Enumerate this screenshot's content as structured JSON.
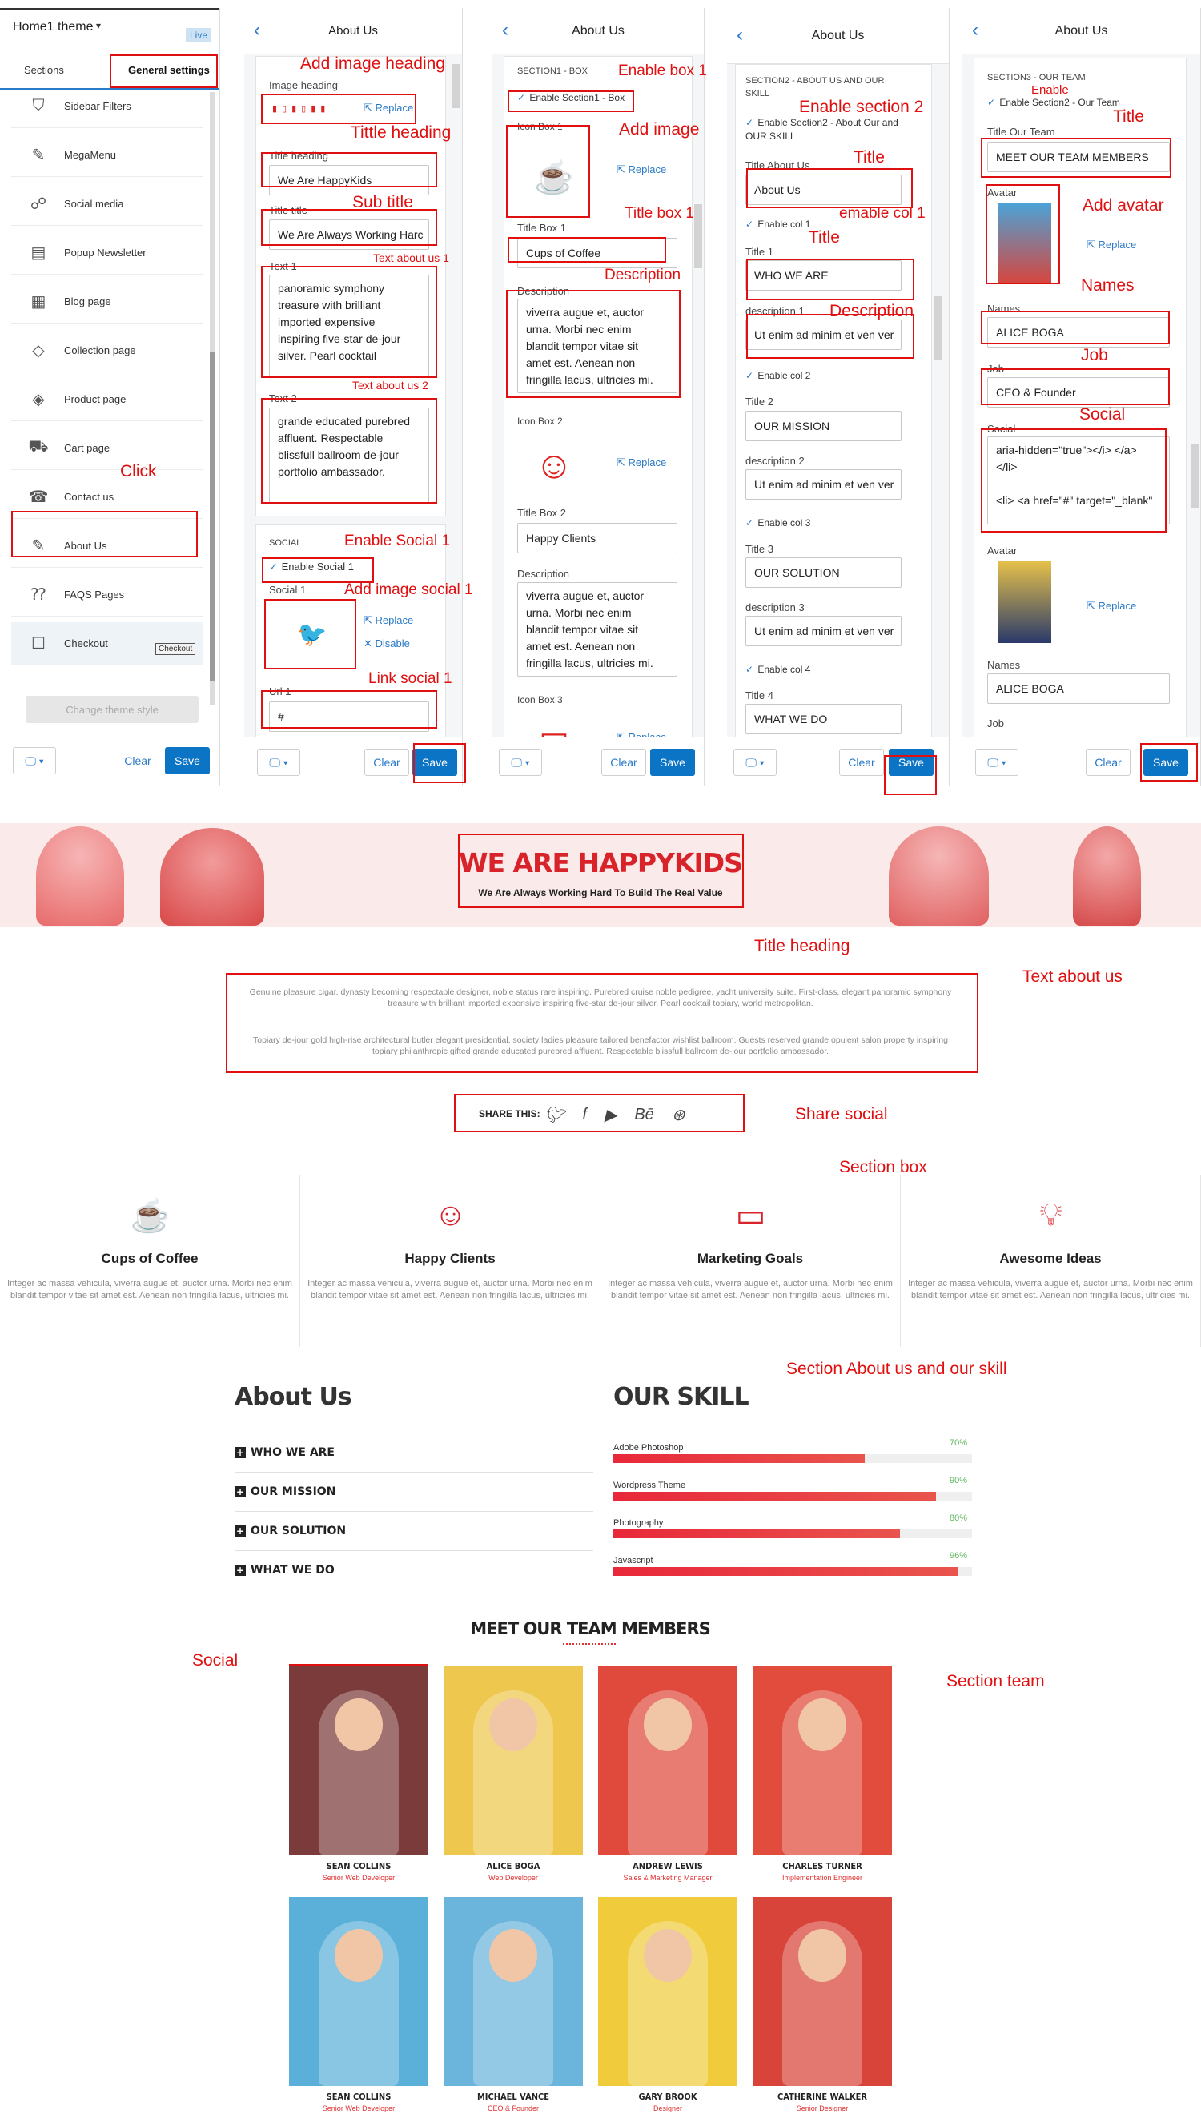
{
  "panel1": {
    "theme_name": "Home1 theme",
    "live_badge": "Live",
    "tab_sections": "Sections",
    "tab_general": "General settings",
    "items": [
      "Sidebar Filters",
      "MegaMenu",
      "Social media",
      "Popup Newsletter",
      "Blog page",
      "Collection page",
      "Product page",
      "Cart page",
      "Contact us",
      "About Us",
      "FAQS Pages",
      "Checkout"
    ],
    "tooltip": "Checkout",
    "change_style": "Change theme style",
    "clear": "Clear",
    "save": "Save"
  },
  "panel2": {
    "title": "About Us",
    "image_heading_label": "Image heading",
    "replace": "Replace",
    "title_heading_label": "Title heading",
    "title_heading_value": "We Are HappyKids",
    "title_title_label": "Title title",
    "title_title_value": "We Are Always Working Harc",
    "text1_label": "Text 1",
    "text1_value": "panoramic symphony treasure with brilliant imported expensive inspiring five-star de-jour silver. Pearl cocktail",
    "text2_label": "Text 2",
    "text2_value": "grande educated purebred affluent. Respectable blissfull ballroom de-jour portfolio ambassador.",
    "social_heading": "SOCIAL",
    "enable_social1": "Enable Social 1",
    "social1_label": "Social 1",
    "disable": "Disable",
    "url1_label": "Url 1",
    "url1_value": "#",
    "clear": "Clear",
    "save": "Save"
  },
  "panel3": {
    "title": "About Us",
    "section_heading": "SECTION1 - BOX",
    "enable_box": "Enable Section1 - Box",
    "icon_box1": "Icon Box 1",
    "title_box1_label": "Title Box 1",
    "title_box1_value": "Cups of Coffee",
    "desc_label": "Description",
    "desc_value": "viverra augue et, auctor urna. Morbi nec enim blandit tempor vitae sit amet est. Aenean non fringilla lacus, ultricies mi.",
    "icon_box2": "Icon Box 2",
    "title_box2_label": "Title Box 2",
    "title_box2_value": "Happy Clients",
    "desc2_label": "Description",
    "desc2_value": "viverra augue et, auctor urna. Morbi nec enim blandit tempor vitae sit amet est. Aenean non fringilla lacus, ultricies mi.",
    "icon_box3": "Icon Box 3",
    "replace": "Replace",
    "clear": "Clear",
    "save": "Save"
  },
  "panel4": {
    "title": "About Us",
    "section_heading": "SECTION2 - ABOUT US AND OUR SKILL",
    "enable_section2": "Enable Section2 - About Our and OUR SKILL",
    "title_about_label": "Title About Us",
    "title_about_value": "About Us",
    "enable_col1": "Enable col 1",
    "title1_label": "Title 1",
    "title1_value": "WHO WE ARE",
    "desc1_label": "description 1",
    "desc1_value": "Ut enim ad minim et ven ver",
    "enable_col2": "Enable col 2",
    "title2_label": "Title 2",
    "title2_value": "OUR MISSION",
    "desc2_label": "description 2",
    "desc2_value": "Ut enim ad minim et ven ver",
    "enable_col3": "Enable col 3",
    "title3_label": "Title 3",
    "title3_value": "OUR SOLUTION",
    "desc3_label": "description 3",
    "desc3_value": "Ut enim ad minim et ven ver",
    "enable_col4": "Enable col 4",
    "title4_label": "Title 4",
    "title4_value": "WHAT WE DO",
    "clear": "Clear",
    "save": "Save"
  },
  "panel5": {
    "title": "About Us",
    "section_heading": "SECTION3 - OUR TEAM",
    "enable_section2": "Enable Section2 - Our Team",
    "title_team_label": "Title Our Team",
    "title_team_value": "MEET OUR TEAM MEMBERS",
    "avatar_label": "Avatar",
    "replace": "Replace",
    "names_label": "Names",
    "names_value": "ALICE BOGA",
    "job_label": "Job",
    "job_value": "CEO & Founder",
    "social_label": "Social",
    "social_value": "aria-hidden=\"true\"></i> </a></li>\n\n<li> <a href=\"#\" target=\"_blank\"",
    "avatar2_label": "Avatar",
    "names2_label": "Names",
    "names2_value": "ALICE BOGA",
    "job2_label": "Job",
    "clear": "Clear",
    "save": "Save"
  },
  "annotations": {
    "add_image_heading": "Add image heading",
    "tittle_heading": "Tittle heading",
    "sub_title": "Sub title",
    "text_about_us_1": "Text about us 1",
    "text_about_us_2": "Text about us 2",
    "click": "Click",
    "enable_social_1": "Enable Social 1",
    "add_image_social_1": "Add image social 1",
    "link_social_1": "Link social 1",
    "enable_box_1": "Enable box 1",
    "add_image": "Add image",
    "title_box_1": "Title box 1",
    "description": "Description",
    "enable_section_2": "Enable section 2",
    "title": "Title",
    "emable_col_1": "emable col 1",
    "title_b": "Title",
    "description_b": "Description",
    "enable": "Enable",
    "title_c": "Title",
    "add_avatar": "Add avatar",
    "names": "Names",
    "job": "Job",
    "social": "Social",
    "title_heading_front": "Title heading",
    "text_about_us": "Text about us",
    "share_social": "Share social",
    "section_box": "Section box",
    "section_about_skill": "Section About us and our skill",
    "social_front": "Social",
    "section_team": "Section team"
  },
  "front": {
    "hero_title": "WE ARE HAPPYKIDS",
    "hero_sub": "We Are Always Working Hard To Build The Real Value",
    "about_p1": "Genuine pleasure cigar, dynasty becoming respectable designer, noble status rare inspiring. Purebred cruise noble pedigree, yacht university suite. First-class, elegant panoramic symphony treasure with brilliant imported expensive inspiring five-star de-jour silver. Pearl cocktail topiary, world metropolitan.",
    "about_p2": "Topiary de-jour gold high-rise architectural butler elegant presidential, society ladies pleasure tailored benefactor wishlist ballroom. Guests reserved grande opulent salon property inspiring topiary philanthropic gifted grande educated purebred affluent. Respectable blissfull ballroom de-jour portfolio ambassador.",
    "share_label": "SHARE THIS:",
    "share_icons": [
      "twitter-icon",
      "facebook-icon",
      "youtube-icon",
      "behance-icon",
      "dribbble-icon"
    ],
    "boxes": [
      {
        "title": "Cups of Coffee",
        "desc": "Integer ac massa vehicula, viverra augue et, auctor urna. Morbi nec enim blandit tempor vitae sit amet est. Aenean non fringilla lacus, ultricies mi.",
        "icon": "coffee-cup-icon"
      },
      {
        "title": "Happy Clients",
        "desc": "Integer ac massa vehicula, viverra augue et, auctor urna. Morbi nec enim blandit tempor vitae sit amet est. Aenean non fringilla lacus, ultricies mi.",
        "icon": "smiley-icon"
      },
      {
        "title": "Marketing Goals",
        "desc": "Integer ac massa vehicula, viverra augue et, auctor urna. Morbi nec enim blandit tempor vitae sit amet est. Aenean non fringilla lacus, ultricies mi.",
        "icon": "presentation-icon"
      },
      {
        "title": "Awesome Ideas",
        "desc": "Integer ac massa vehicula, viverra augue et, auctor urna. Morbi nec enim blandit tempor vitae sit amet est. Aenean non fringilla lacus, ultricies mi.",
        "icon": "lightbulb-icon"
      }
    ],
    "about_title": "About Us",
    "accordion": [
      "WHO WE ARE",
      "OUR MISSION",
      "OUR SOLUTION",
      "WHAT WE DO"
    ],
    "skill_title": "OUR SKILL",
    "skills": [
      {
        "name": "Adobe Photoshop",
        "pct": "70%",
        "value": 0.7
      },
      {
        "name": "Wordpress Theme",
        "pct": "90%",
        "value": 0.9
      },
      {
        "name": "Photography",
        "pct": "80%",
        "value": 0.8
      },
      {
        "name": "Javascript",
        "pct": "96%",
        "value": 0.96
      }
    ],
    "team_title": "MEET OUR TEAM MEMBERS",
    "members": [
      {
        "name": "SEAN COLLINS",
        "job": "Senior Web Developer",
        "bg": "#7b3b3b"
      },
      {
        "name": "ALICE BOGA",
        "job": "Web Developer",
        "bg": "#eec84e"
      },
      {
        "name": "ANDREW LEWIS",
        "job": "Sales & Marketing Manager",
        "bg": "#df4a3c"
      },
      {
        "name": "CHARLES TURNER",
        "job": "Implementation Engineer",
        "bg": "#e14c3c"
      },
      {
        "name": "SEAN COLLINS",
        "job": "Senior Web Developer",
        "bg": "#5ab0d8"
      },
      {
        "name": "MICHAEL VANCE",
        "job": "CEO & Founder",
        "bg": "#6bb4dc"
      },
      {
        "name": "GARY BROOK",
        "job": "Designer",
        "bg": "#f0cc3c"
      },
      {
        "name": "CATHERINE WALKER",
        "job": "Senior Designer",
        "bg": "#d8443a"
      }
    ]
  },
  "colors": {
    "accent": "#0b74c4",
    "annotation": "#e01010",
    "brand_red": "#d8232a"
  }
}
